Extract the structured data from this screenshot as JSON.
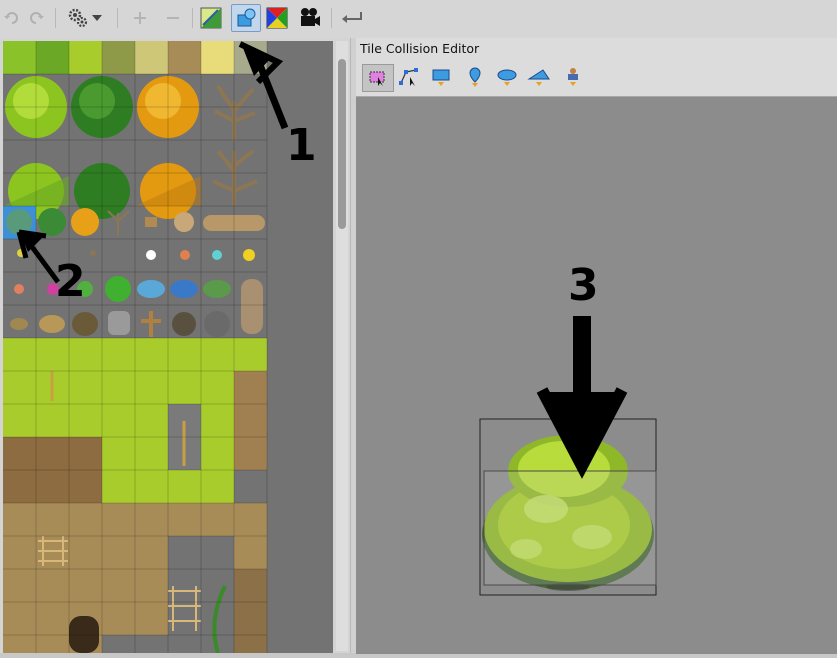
{
  "toolbar": {
    "buttons": [
      {
        "name": "undo",
        "icon": "undo-icon",
        "enabled": false
      },
      {
        "name": "redo",
        "icon": "redo-icon",
        "enabled": false
      },
      {
        "name": "settings",
        "icon": "gears-icon",
        "enabled": true
      },
      {
        "name": "settings-dropdown",
        "icon": "chevron-down-icon",
        "enabled": true
      },
      {
        "name": "zoom-in",
        "icon": "plus-icon",
        "enabled": false
      },
      {
        "name": "zoom-out",
        "icon": "minus-icon",
        "enabled": false
      },
      {
        "name": "edit-terrain",
        "icon": "terrain-icon",
        "enabled": true
      },
      {
        "name": "edit-collision",
        "icon": "collision-shapes-icon",
        "enabled": true,
        "active": true
      },
      {
        "name": "edit-wang-colors",
        "icon": "color-square-icon",
        "enabled": true
      },
      {
        "name": "tile-animation",
        "icon": "film-camera-icon",
        "enabled": true
      },
      {
        "name": "back",
        "icon": "return-arrow-icon",
        "enabled": true
      }
    ]
  },
  "editor": {
    "title": "Tile Collision Editor",
    "tools": [
      {
        "name": "select-objects",
        "icon": "select-objects-icon",
        "active": true
      },
      {
        "name": "edit-polygons",
        "icon": "edit-polygons-icon"
      },
      {
        "name": "insert-rectangle",
        "icon": "rectangle-icon"
      },
      {
        "name": "insert-point",
        "icon": "point-pin-icon"
      },
      {
        "name": "insert-ellipse",
        "icon": "ellipse-icon"
      },
      {
        "name": "insert-polygon",
        "icon": "polygon-icon"
      },
      {
        "name": "insert-template",
        "icon": "template-stamp-icon"
      }
    ]
  },
  "annotations": {
    "one": "1",
    "two": "2",
    "three": "3"
  },
  "colors": {
    "accent": "#3d8fd6",
    "grass": "#a8cc2c",
    "dark_tree": "#2e7d22",
    "orange_tree": "#e39a10",
    "dirt": "#a88c58"
  }
}
